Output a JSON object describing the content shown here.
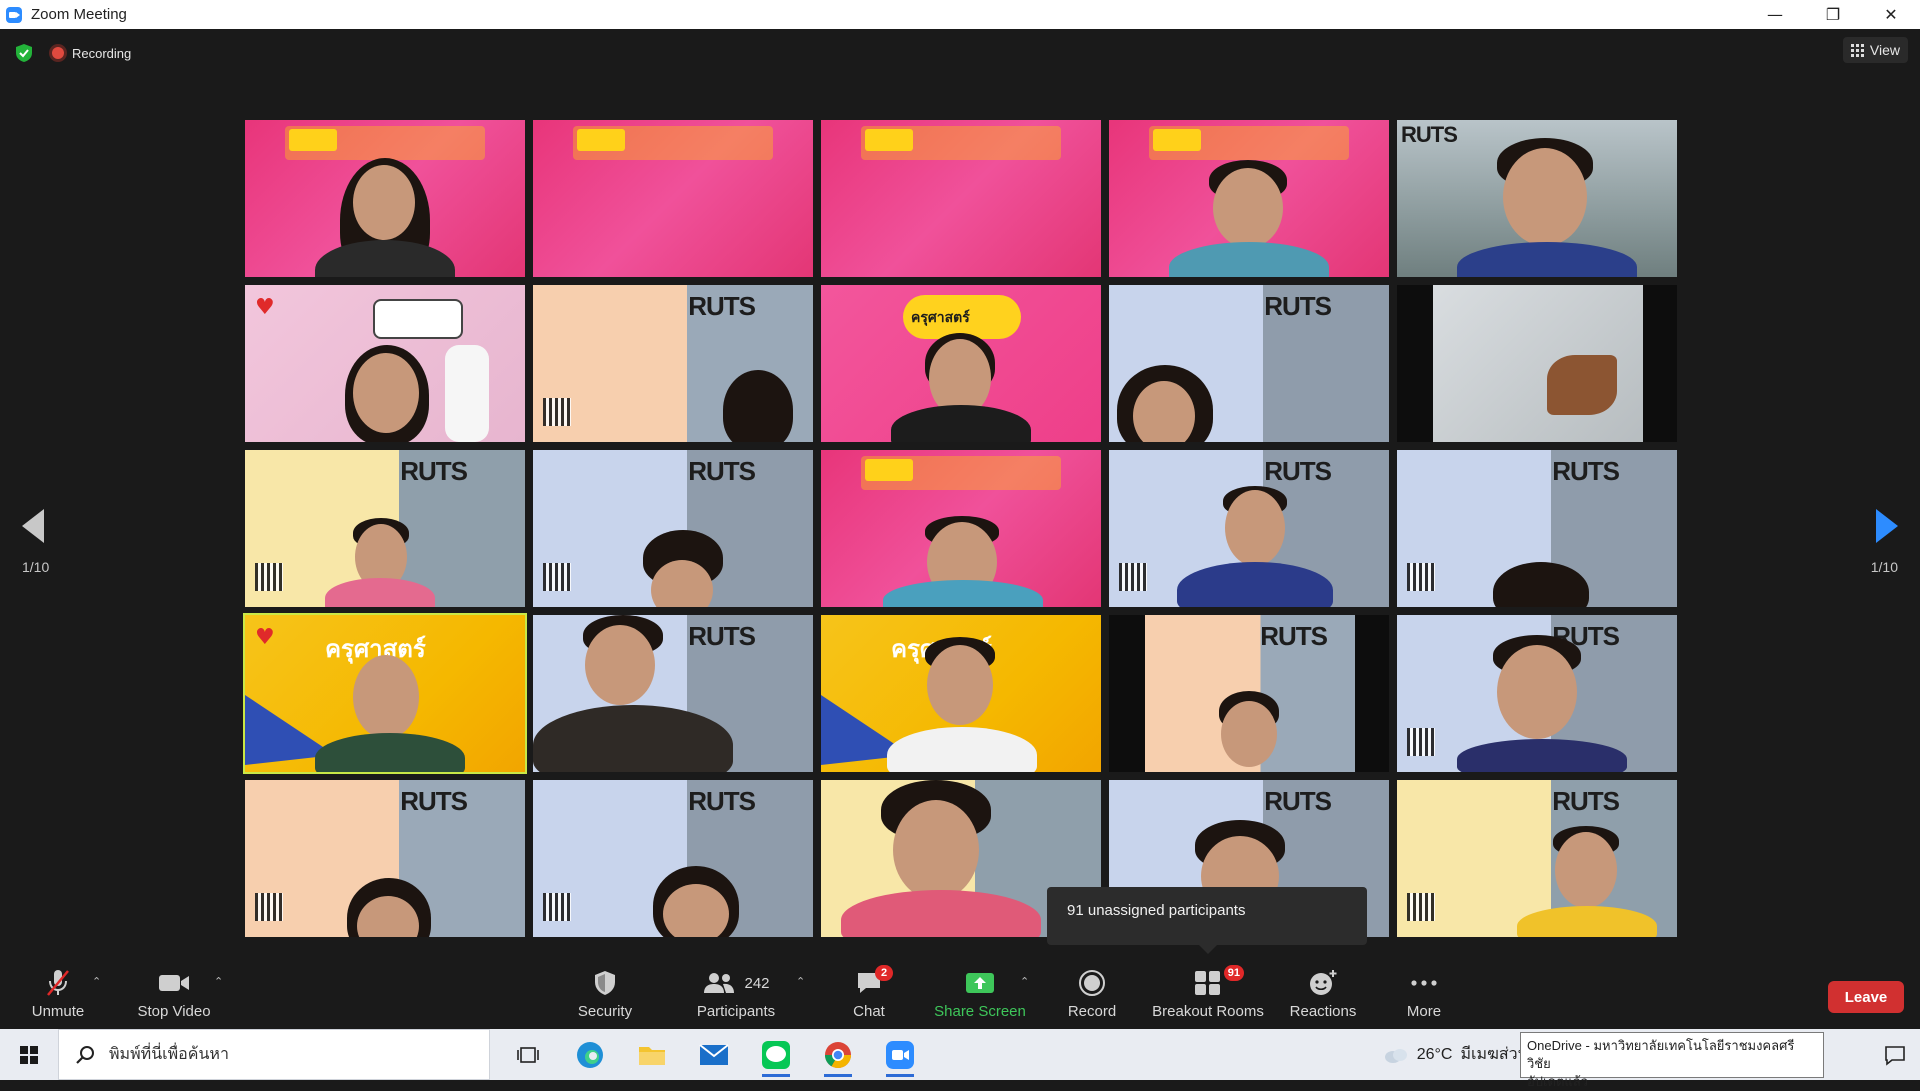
{
  "window": {
    "title": "Zoom Meeting",
    "controls": [
      "—",
      "❐",
      "✕"
    ]
  },
  "meeting": {
    "recording_label": "Recording",
    "view_label": "View",
    "page_left": "1/10",
    "page_right": "1/10",
    "tooltip": "91 unassigned participants"
  },
  "toolbar": {
    "unmute": "Unmute",
    "stop_video": "Stop Video",
    "security": "Security",
    "participants": "Participants",
    "participants_count": "242",
    "chat": "Chat",
    "chat_badge": "2",
    "share_screen": "Share Screen",
    "record": "Record",
    "breakout_rooms": "Breakout Rooms",
    "breakout_badge": "91",
    "reactions": "Reactions",
    "more": "More",
    "leave": "Leave"
  },
  "taskbar": {
    "search_placeholder": "พิมพ์ที่นี่เพื่อค้นหา",
    "temperature": "26°C",
    "weather_text": "มีเมฆส่วนใหญ่",
    "toast_line1": "OneDrive - มหาวิทยาลัยเทคโนโลยีราชมงคลศรีวิชัย",
    "toast_line2": "อัปเดตแล้ว"
  },
  "tiles": {
    "logo_text": "RUTS",
    "faculty_text": "ครุศาสตร์"
  },
  "colors": {
    "accent": "#2d8cff",
    "share": "#3ec65a",
    "leave": "#d13030",
    "badge": "#e02828"
  }
}
